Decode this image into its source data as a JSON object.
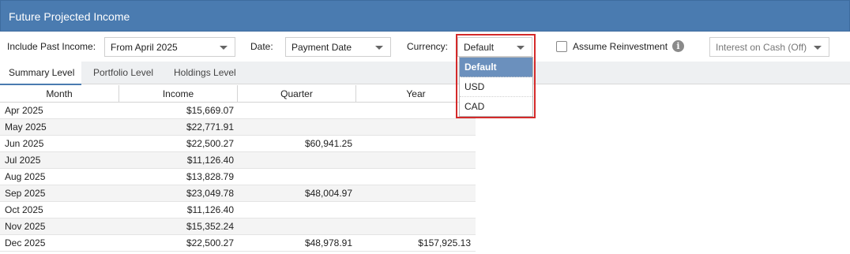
{
  "title": "Future Projected Income",
  "toolbar": {
    "include_past_label": "Include Past Income:",
    "include_past_value": "From April 2025",
    "date_label": "Date:",
    "date_value": "Payment Date",
    "currency_label": "Currency:",
    "currency_value": "Default",
    "assume_reinvestment_label": "Assume Reinvestment",
    "assume_reinvestment_checked": false,
    "info_icon": "info-icon",
    "interest_on_cash_value": "Interest on Cash (Off)"
  },
  "tabs": [
    {
      "label": "Summary Level",
      "active": true
    },
    {
      "label": "Portfolio Level",
      "active": false
    },
    {
      "label": "Holdings Level",
      "active": false
    }
  ],
  "grid": {
    "headers": [
      "Month",
      "Income",
      "Quarter",
      "Year"
    ],
    "rows": [
      {
        "month": "Apr 2025",
        "income": "$15,669.07",
        "quarter": "",
        "year": ""
      },
      {
        "month": "May 2025",
        "income": "$22,771.91",
        "quarter": "",
        "year": ""
      },
      {
        "month": "Jun 2025",
        "income": "$22,500.27",
        "quarter": "$60,941.25",
        "year": ""
      },
      {
        "month": "Jul 2025",
        "income": "$11,126.40",
        "quarter": "",
        "year": ""
      },
      {
        "month": "Aug 2025",
        "income": "$13,828.79",
        "quarter": "",
        "year": ""
      },
      {
        "month": "Sep 2025",
        "income": "$23,049.78",
        "quarter": "$48,004.97",
        "year": ""
      },
      {
        "month": "Oct 2025",
        "income": "$11,126.40",
        "quarter": "",
        "year": ""
      },
      {
        "month": "Nov 2025",
        "income": "$15,352.24",
        "quarter": "",
        "year": ""
      },
      {
        "month": "Dec 2025",
        "income": "$22,500.27",
        "quarter": "$48,978.91",
        "year": "$157,925.13"
      }
    ]
  },
  "currency_dropdown": {
    "options": [
      "Default",
      "USD",
      "CAD"
    ],
    "selected": "Default"
  },
  "colors": {
    "header_blue": "#4a7bb0",
    "selected_option": "#6b90bd",
    "highlight_red": "#d42a2a"
  }
}
